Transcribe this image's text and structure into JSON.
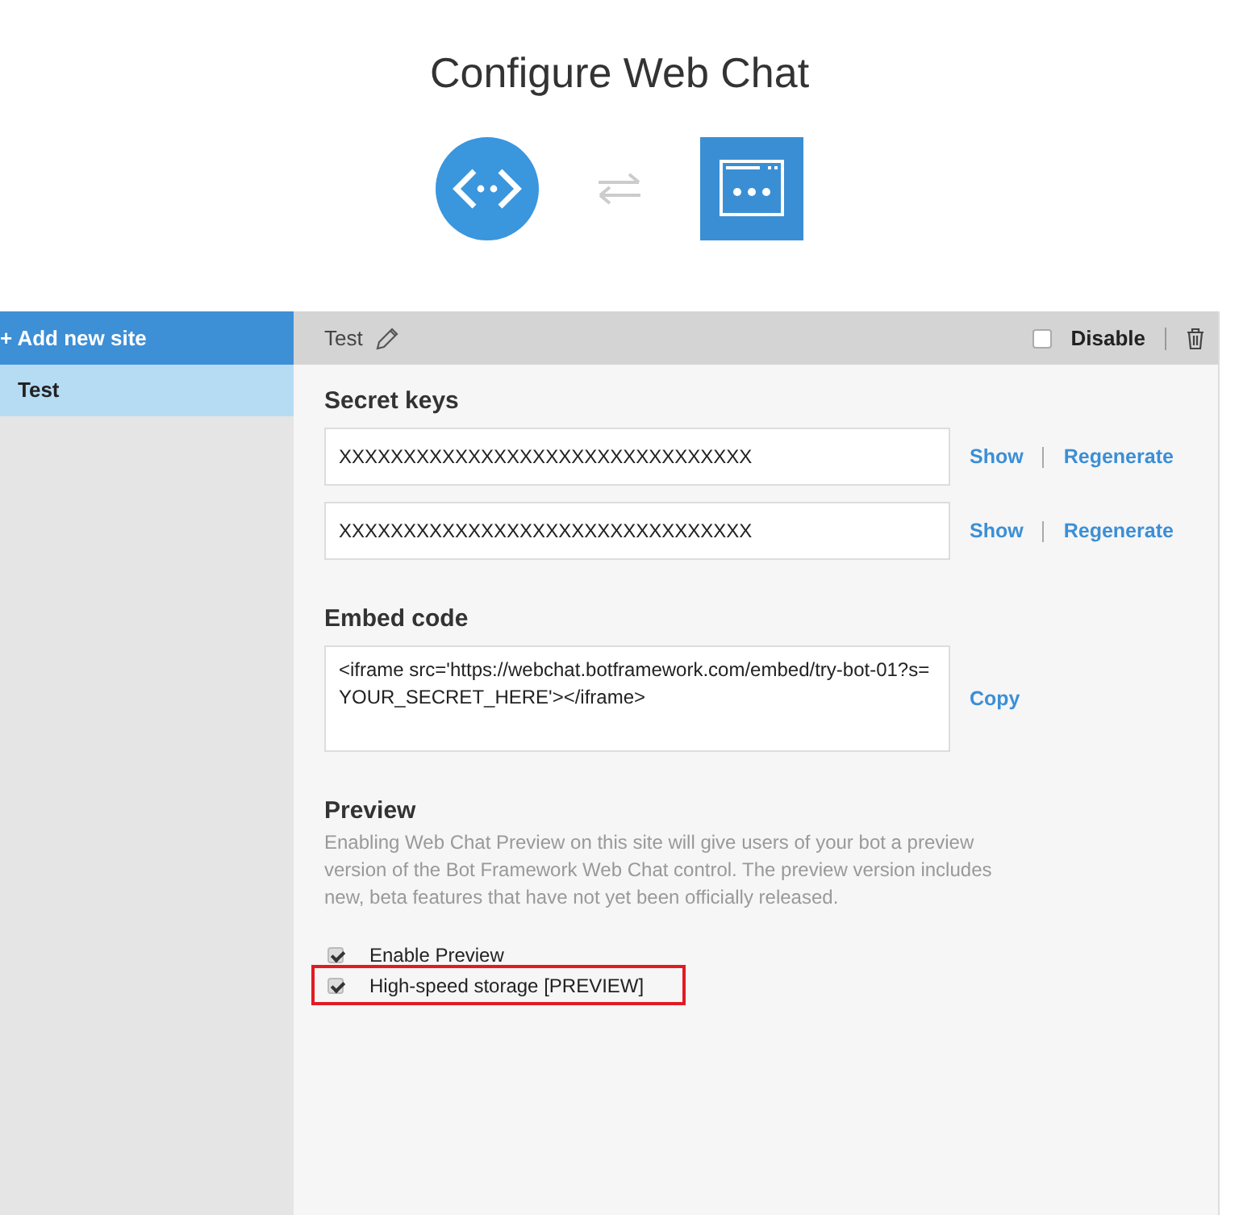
{
  "title": "Configure Web Chat",
  "sidebar": {
    "add_button": "+ Add new site",
    "items": [
      {
        "label": "Test",
        "selected": true
      }
    ]
  },
  "site_bar": {
    "name": "Test",
    "disable": {
      "label": "Disable",
      "checked": false
    }
  },
  "secret_keys": {
    "heading": "Secret keys",
    "keys": [
      {
        "value": "XXXXXXXXXXXXXXXXXXXXXXXXXXXXXXXX",
        "show": "Show",
        "regenerate": "Regenerate"
      },
      {
        "value": "XXXXXXXXXXXXXXXXXXXXXXXXXXXXXXXX",
        "show": "Show",
        "regenerate": "Regenerate"
      }
    ]
  },
  "embed": {
    "heading": "Embed code",
    "code": "<iframe src='https://webchat.botframework.com/embed/try-bot-01?s=YOUR_SECRET_HERE'></iframe>",
    "copy": "Copy"
  },
  "preview": {
    "heading": "Preview",
    "description": "Enabling Web Chat Preview on this site will give users of your bot a preview version of the Bot Framework Web Chat control. The preview version includes new, beta features that have not yet been officially released.",
    "options": [
      {
        "label": "Enable Preview",
        "checked": true,
        "highlighted": false
      },
      {
        "label": "High-speed storage [PREVIEW]",
        "checked": true,
        "highlighted": true
      }
    ]
  }
}
